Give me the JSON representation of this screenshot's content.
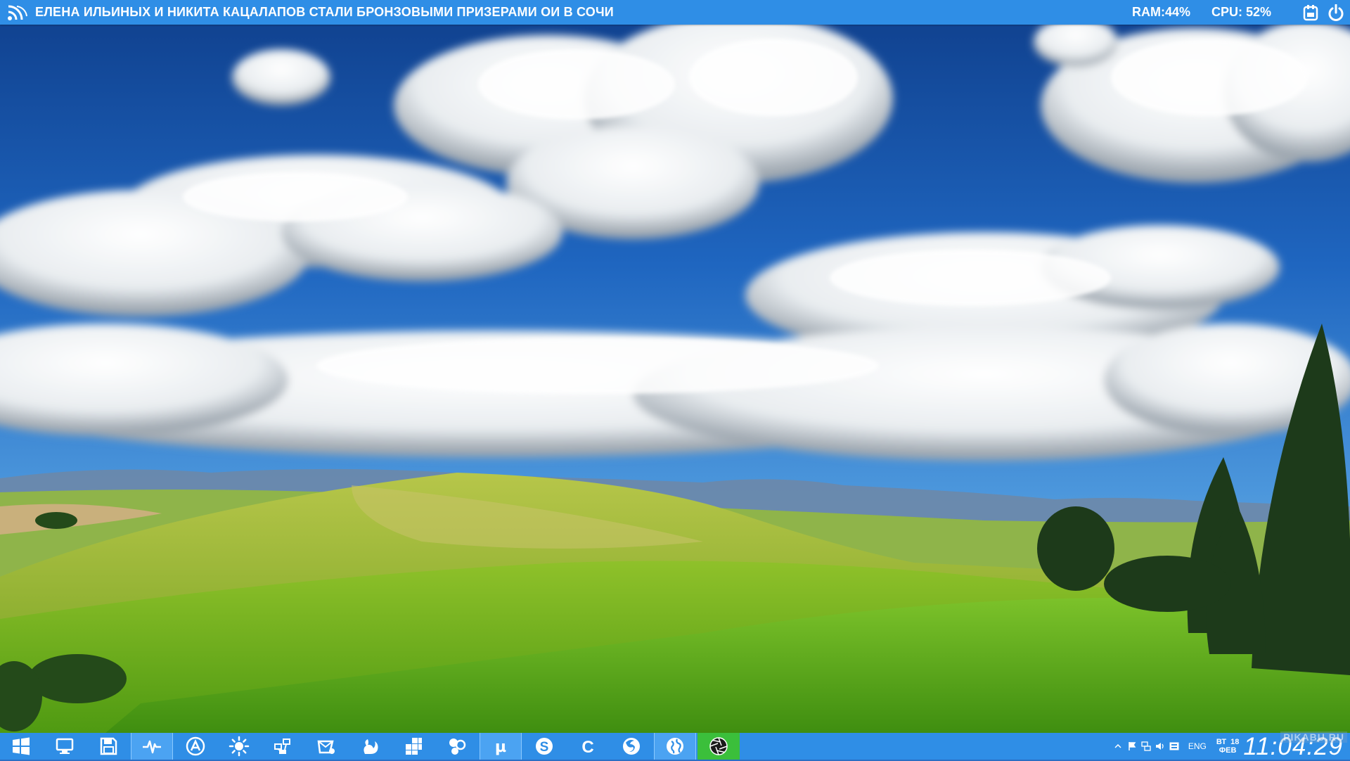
{
  "topbar": {
    "news_headline": "ЕЛЕНА ИЛЬИНЫХ И НИКИТА КАЦАЛАПОВ СТАЛИ БРОНЗОВЫМИ ПРИЗЕРАМИ ОИ В СОЧИ",
    "ram": "RAM:44%",
    "cpu": "CPU: 52%",
    "icons": [
      "rss-icon",
      "calendar-icon",
      "power-icon"
    ]
  },
  "taskbar": {
    "buttons": [
      {
        "name": "start-button",
        "icon": "windows-logo-icon"
      },
      {
        "name": "computer-button",
        "icon": "monitor-icon"
      },
      {
        "name": "save-button",
        "icon": "floppy-disk-icon"
      },
      {
        "name": "activity-button",
        "icon": "pulse-icon",
        "active": true
      },
      {
        "name": "appstore-button",
        "icon": "circle-a-icon"
      },
      {
        "name": "weather-button",
        "icon": "sun-icon"
      },
      {
        "name": "network-button",
        "icon": "network-icon"
      },
      {
        "name": "mail-button",
        "icon": "mail-icon"
      },
      {
        "name": "squirrel-app-button",
        "icon": "squirrel-icon"
      },
      {
        "name": "puzzle-app-button",
        "icon": "puzzle-icon"
      },
      {
        "name": "bubbles-app-button",
        "icon": "bubbles-icon"
      },
      {
        "name": "utorrent-button",
        "icon": "utorrent-icon",
        "active": true,
        "label": "µ"
      },
      {
        "name": "skype-button",
        "icon": "skype-icon",
        "label": "S"
      },
      {
        "name": "c-app-button",
        "icon": "c-logo-icon",
        "label": "C"
      },
      {
        "name": "firefox-button",
        "icon": "firefox-icon"
      },
      {
        "name": "browser-button",
        "icon": "globe-icon",
        "active": true
      },
      {
        "name": "aperture-app-button",
        "icon": "aperture-icon",
        "green": true
      }
    ]
  },
  "tray": {
    "language": "ENG",
    "day": "ВТ",
    "day_num": "18",
    "month": "ФЕВ",
    "time": "11:04:29",
    "watermark": "PIKABU.RU",
    "icons": [
      "chevron-up-icon",
      "flag-icon",
      "network-tray-icon",
      "volume-icon",
      "keyboard-icon"
    ]
  },
  "colors": {
    "bar": "#2f8ee6",
    "active_button": "#4ba3f2",
    "green_button": "#3bbf3b"
  }
}
